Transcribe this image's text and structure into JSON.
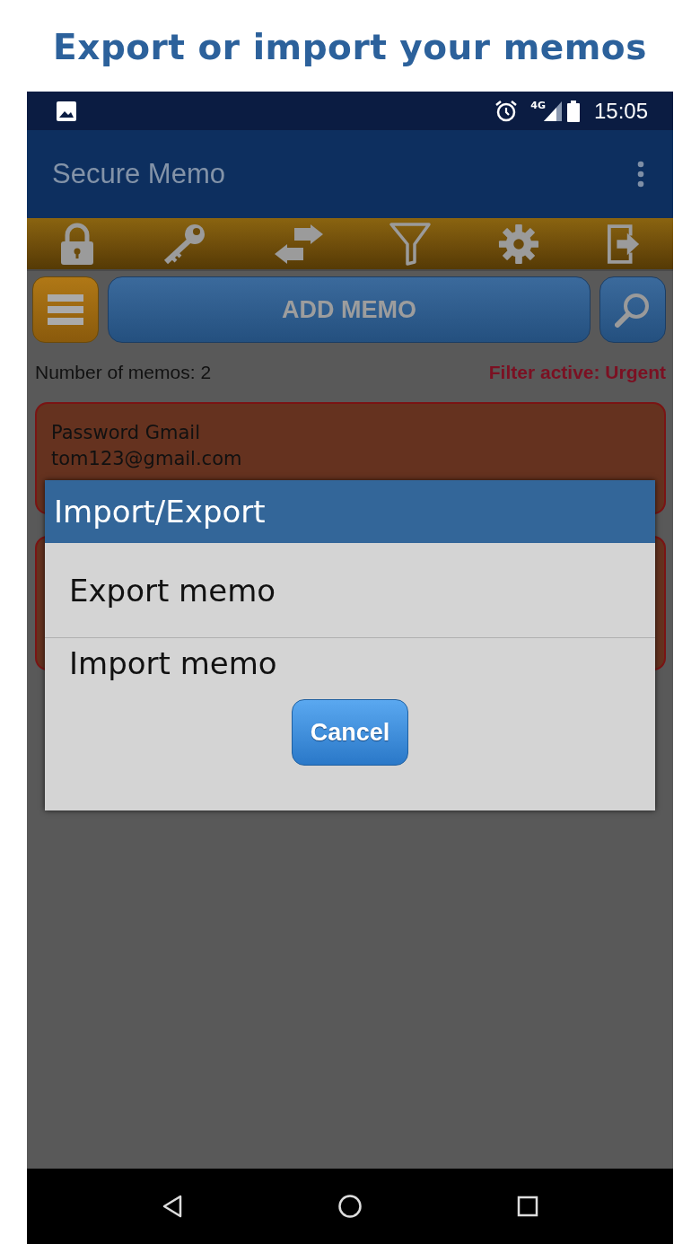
{
  "headline": "Export or import your memos",
  "status_bar": {
    "time": "15:05",
    "network": "4G"
  },
  "app_bar": {
    "title": "Secure Memo"
  },
  "add_button": {
    "label": "ADD MEMO"
  },
  "summary": {
    "count": "Number of memos: 2",
    "filter": "Filter active: Urgent"
  },
  "memos": [
    {
      "title": "Password Gmail",
      "detail": "tom123@gmail.com"
    },
    {
      "kind": "hidden"
    }
  ],
  "dialog": {
    "title": "Import/Export",
    "options": [
      "Export memo",
      "Import memo"
    ],
    "cancel": "Cancel"
  }
}
